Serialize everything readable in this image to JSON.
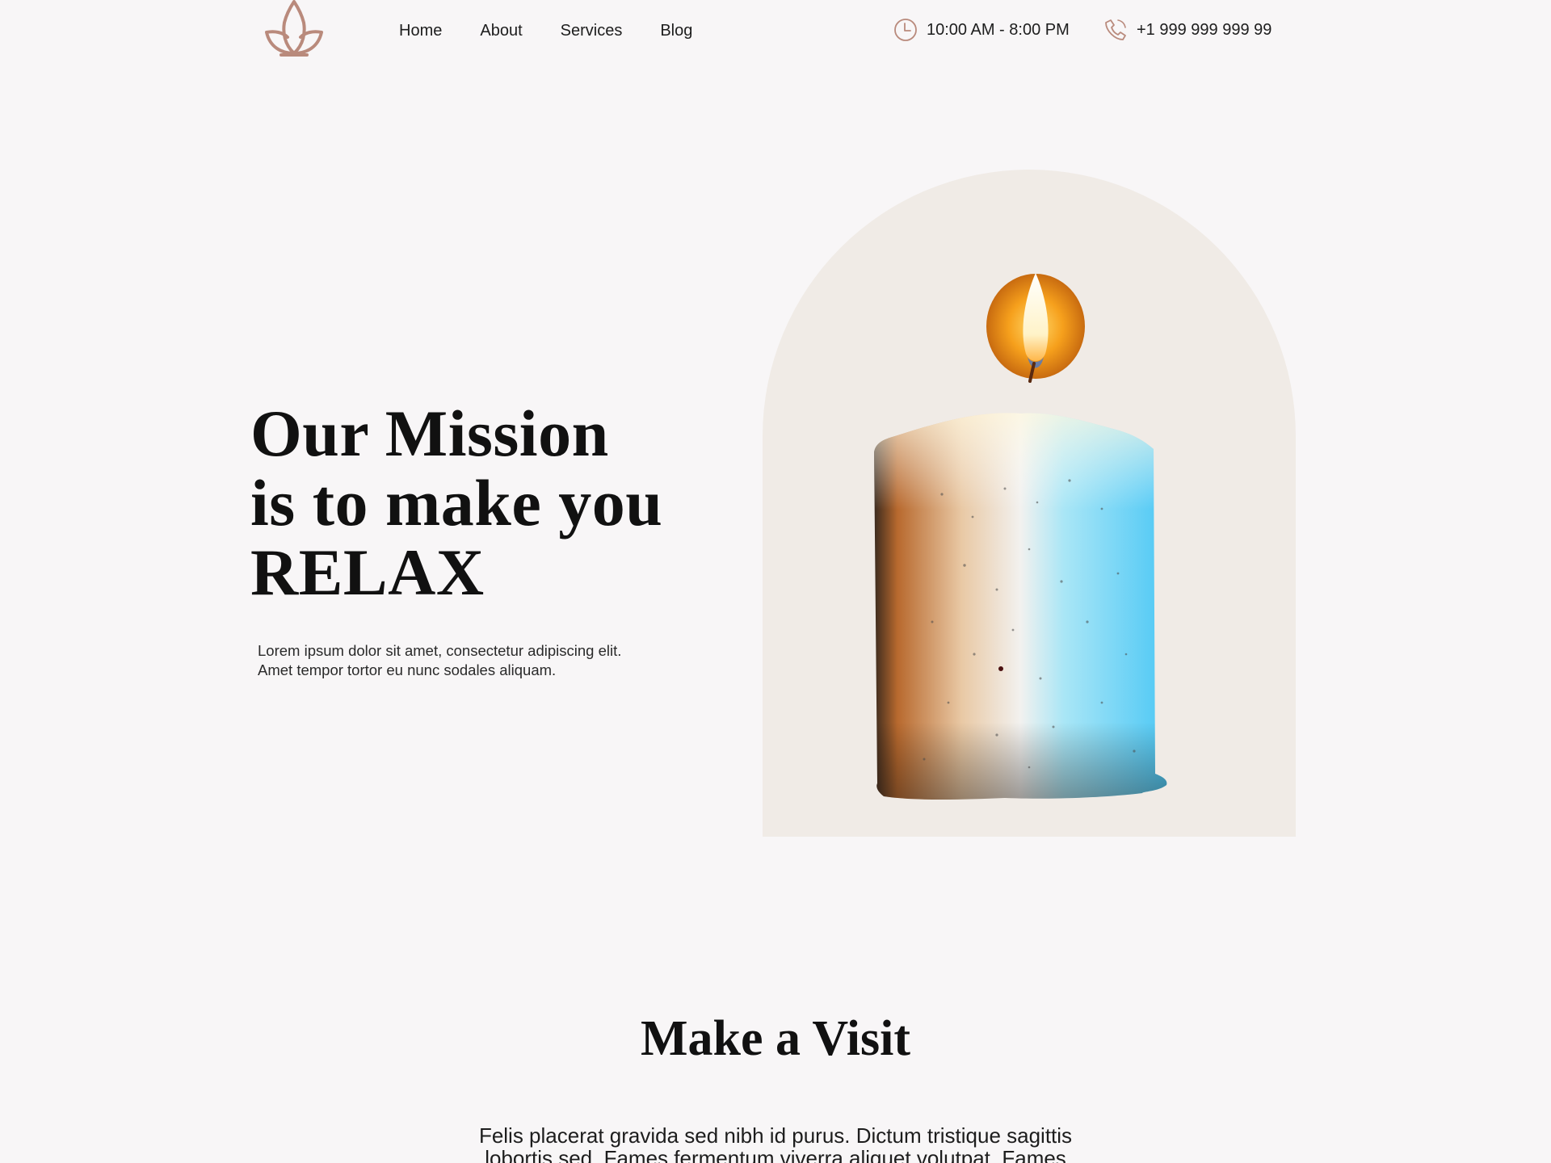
{
  "header": {
    "logo_name": "lotus-logo",
    "nav": [
      {
        "label": "Home"
      },
      {
        "label": "About"
      },
      {
        "label": "Services"
      },
      {
        "label": "Blog"
      }
    ],
    "hours": {
      "icon": "clock-icon",
      "text": "10:00 AM - 8:00 PM"
    },
    "phone": {
      "icon": "phone-icon",
      "text": "+1 999 999 999 99"
    }
  },
  "hero": {
    "title_lines": [
      "Our Mission",
      "is to make you",
      "RELAX"
    ],
    "text_lines": [
      "Lorem ipsum dolor sit amet, consectetur adipiscing elit.",
      "Amet tempor tortor eu nunc sodales aliquam."
    ],
    "image_name": "candle-image"
  },
  "visit": {
    "title": "Make a Visit",
    "text_lines": [
      "Felis placerat gravida sed nibh id purus. Dictum tristique sagittis",
      "lobortis sed. Fames fermentum viverra aliquet volutpat. Fames"
    ]
  },
  "colors": {
    "background": "#f8f6f7",
    "accent": "#b98a7c",
    "arch": "#f0ebe6",
    "text": "#1a1a1a"
  }
}
